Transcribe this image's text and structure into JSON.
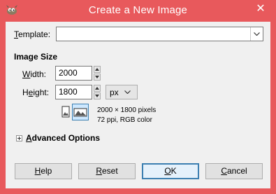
{
  "window": {
    "title": "Create a New Image",
    "close_symbol": "✕",
    "icon": "gimp-wilber-icon"
  },
  "template": {
    "label_mnemonic": "T",
    "label_rest": "emplate:",
    "value": ""
  },
  "image_size": {
    "heading": "Image Size",
    "width_label_mnemonic": "W",
    "width_label_rest": "idth:",
    "width_value": "2000",
    "height_label_pre": "H",
    "height_label_mnemonic": "e",
    "height_label_rest": "ight:",
    "height_value": "1800",
    "unit": "px",
    "info_dimensions": "2000 × 1800 pixels",
    "info_resolution": "72 ppi, RGB color",
    "orientation_selected": "landscape"
  },
  "advanced": {
    "label_mnemonic": "A",
    "label_rest": "dvanced Options",
    "expanded": false
  },
  "buttons": {
    "help_mnemonic": "H",
    "help_rest": "elp",
    "reset_mnemonic": "R",
    "reset_rest": "eset",
    "ok_mnemonic": "O",
    "ok_rest": "K",
    "cancel_mnemonic": "C",
    "cancel_rest": "ancel"
  },
  "colors": {
    "titlebar": "#e8595c",
    "client": "#f0f0f0",
    "default_button_border": "#3c7fb1",
    "selected_toggle_bg": "#cde8ff"
  }
}
